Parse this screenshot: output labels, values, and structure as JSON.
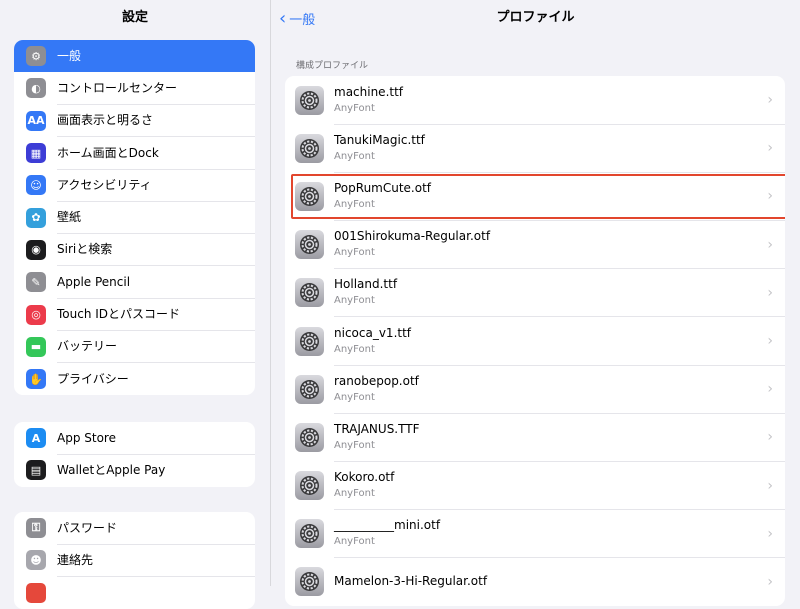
{
  "left": {
    "title": "設定",
    "group1": [
      {
        "label": "一般",
        "icon": "gear-icon",
        "color": "#8e8e93",
        "glyph": "⚙",
        "selected": true
      },
      {
        "label": "コントロールセンター",
        "icon": "toggles-icon",
        "color": "#8e8e93",
        "glyph": "◐"
      },
      {
        "label": "画面表示と明るさ",
        "icon": "text-size-icon",
        "color": "#3478f6",
        "glyph": "AA"
      },
      {
        "label": "ホーム画面とDock",
        "icon": "home-grid-icon",
        "color": "#3d3dd6",
        "glyph": "▦"
      },
      {
        "label": "アクセシビリティ",
        "icon": "accessibility-icon",
        "color": "#3478f6",
        "glyph": "☺"
      },
      {
        "label": "壁紙",
        "icon": "wallpaper-icon",
        "color": "#34a0dc",
        "glyph": "✿"
      },
      {
        "label": "Siriと検索",
        "icon": "siri-icon",
        "color": "#1c1c1e",
        "glyph": "◉"
      },
      {
        "label": "Apple Pencil",
        "icon": "pencil-icon",
        "color": "#8e8e93",
        "glyph": "✎"
      },
      {
        "label": "Touch IDとパスコード",
        "icon": "fingerprint-icon",
        "color": "#ec3b4b",
        "glyph": "◎"
      },
      {
        "label": "バッテリー",
        "icon": "battery-icon",
        "color": "#34c759",
        "glyph": "▬"
      },
      {
        "label": "プライバシー",
        "icon": "hand-icon",
        "color": "#3478f6",
        "glyph": "✋"
      }
    ],
    "group2": [
      {
        "label": "App Store",
        "icon": "app-store-icon",
        "color": "#1c8cf2",
        "glyph": "A"
      },
      {
        "label": "WalletとApple Pay",
        "icon": "wallet-icon",
        "color": "#1c1c1e",
        "glyph": "▤"
      }
    ],
    "group3": [
      {
        "label": "パスワード",
        "icon": "key-icon",
        "color": "#8e8e93",
        "glyph": "⚿"
      },
      {
        "label": "連絡先",
        "icon": "contacts-icon",
        "color": "#a7a7ad",
        "glyph": "☻"
      },
      {
        "label": "",
        "icon": "calendar-icon",
        "color": "#e5483b",
        "glyph": ""
      }
    ]
  },
  "right": {
    "back_label": "一般",
    "title": "プロファイル",
    "section_label": "構成プロファイル",
    "profiles": [
      {
        "name": "machine.ttf",
        "sub": "AnyFont"
      },
      {
        "name": "TanukiMagic.ttf",
        "sub": "AnyFont"
      },
      {
        "name": "PopRumCute.otf",
        "sub": "AnyFont",
        "highlighted": true
      },
      {
        "name": "001Shirokuma-Regular.otf",
        "sub": "AnyFont"
      },
      {
        "name": "Holland.ttf",
        "sub": "AnyFont"
      },
      {
        "name": "nicoca_v1.ttf",
        "sub": "AnyFont"
      },
      {
        "name": "ranobepop.otf",
        "sub": "AnyFont"
      },
      {
        "name": "TRAJANUS.TTF",
        "sub": "AnyFont"
      },
      {
        "name": "Kokoro.otf",
        "sub": "AnyFont"
      },
      {
        "name": "__________mini.otf",
        "sub": "AnyFont"
      },
      {
        "name": "Mamelon-3-Hi-Regular.otf",
        "sub": ""
      }
    ]
  },
  "colors": {
    "accent": "#3478f6",
    "highlight": "#e2462d"
  }
}
